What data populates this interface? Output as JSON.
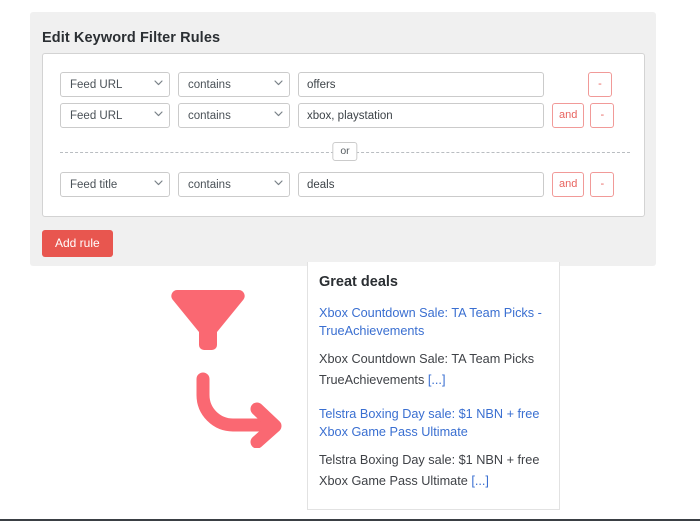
{
  "panel": {
    "title": "Edit Keyword Filter Rules",
    "add_rule_label": "Add rule",
    "or_label": "or",
    "accent_color": "#e8564f",
    "panel_background": "#f0f0f0"
  },
  "rules": [
    {
      "field": "Feed URL",
      "operator": "contains",
      "value": "offers",
      "value_placeholder": "",
      "and_label": "",
      "remove_label": "-",
      "has_and": false
    },
    {
      "field": "Feed URL",
      "operator": "contains",
      "value": "xbox, playstation",
      "value_placeholder": "",
      "and_label": "and",
      "remove_label": "-",
      "has_and": true
    },
    {
      "field": "Feed title",
      "operator": "contains",
      "value": "deals",
      "value_placeholder": "",
      "and_label": "and",
      "remove_label": "-",
      "has_and": true
    }
  ],
  "icons": {
    "chevron_down": "chevron-down-icon",
    "funnel": "funnel-icon",
    "curved_arrow": "curved-arrow-icon"
  },
  "results": {
    "title": "Great deals",
    "link_color": "#3a6fd1",
    "items": [
      {
        "link": "Xbox Countdown Sale: TA Team Picks - TrueAchievements",
        "description": "Xbox Countdown Sale: TA Team Picks  TrueAchievements ",
        "ellipsis": "[...]"
      },
      {
        "link": "Telstra Boxing Day sale: $1 NBN + free Xbox Game Pass Ultimate",
        "description": "Telstra Boxing Day sale: $1 NBN + free Xbox Game Pass Ultimate ",
        "ellipsis": "[...]"
      }
    ]
  }
}
